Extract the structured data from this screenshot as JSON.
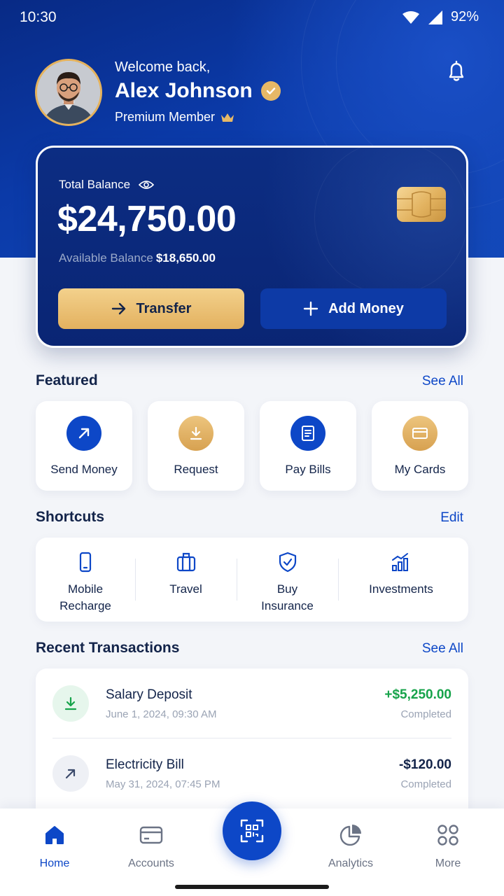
{
  "status_bar": {
    "time": "10:30",
    "battery": "92%"
  },
  "header": {
    "welcome": "Welcome back,",
    "name": "Alex Johnson",
    "membership": "Premium Member",
    "icons": [
      "verified-badge-icon",
      "crown-icon",
      "bell-icon"
    ]
  },
  "balance_card": {
    "label": "Total Balance",
    "amount": "$24,750.00",
    "available_label": "Available Balance",
    "available_amount": "$18,650.00",
    "transfer_label": "Transfer",
    "add_money_label": "Add Money"
  },
  "featured": {
    "title": "Featured",
    "see_all": "See All",
    "items": [
      {
        "label": "Send Money",
        "icon": "arrow-up-right-icon",
        "color": "#0d47c7"
      },
      {
        "label": "Request",
        "icon": "download-icon",
        "color": "#e2b060"
      },
      {
        "label": "Pay Bills",
        "icon": "bill-icon",
        "color": "#0d47c7"
      },
      {
        "label": "My Cards",
        "icon": "card-icon",
        "color": "#e2b060"
      }
    ]
  },
  "shortcuts": {
    "title": "Shortcuts",
    "edit": "Edit",
    "items": [
      {
        "line1": "Mobile",
        "line2": "Recharge",
        "icon": "phone-icon"
      },
      {
        "line1": "Travel",
        "line2": "",
        "icon": "luggage-icon"
      },
      {
        "line1": "Buy",
        "line2": "Insurance",
        "icon": "shield-check-icon"
      },
      {
        "line1": "Investments",
        "line2": "",
        "icon": "bar-chart-icon"
      }
    ]
  },
  "transactions": {
    "title": "Recent Transactions",
    "see_all": "See All",
    "items": [
      {
        "title": "Salary Deposit",
        "date": "June 1, 2024, 09:30 AM",
        "amount": "+$5,250.00",
        "status": "Completed",
        "amount_color": "#16a34a"
      },
      {
        "title": "Electricity Bill",
        "date": "May 31, 2024, 07:45 PM",
        "amount": "-$120.00",
        "status": "Completed",
        "amount_color": "#13244a"
      }
    ]
  },
  "bottom_nav": {
    "items": [
      {
        "label": "Home",
        "active": true
      },
      {
        "label": "Accounts",
        "active": false
      },
      {
        "label": "Analytics",
        "active": false
      },
      {
        "label": "More",
        "active": false
      }
    ],
    "fab_icon": "qr-scan-icon"
  },
  "colors": {
    "primary": "#0d47c7",
    "navy": "#0a2574",
    "gold": "#e2b060",
    "positive": "#16a34a"
  }
}
